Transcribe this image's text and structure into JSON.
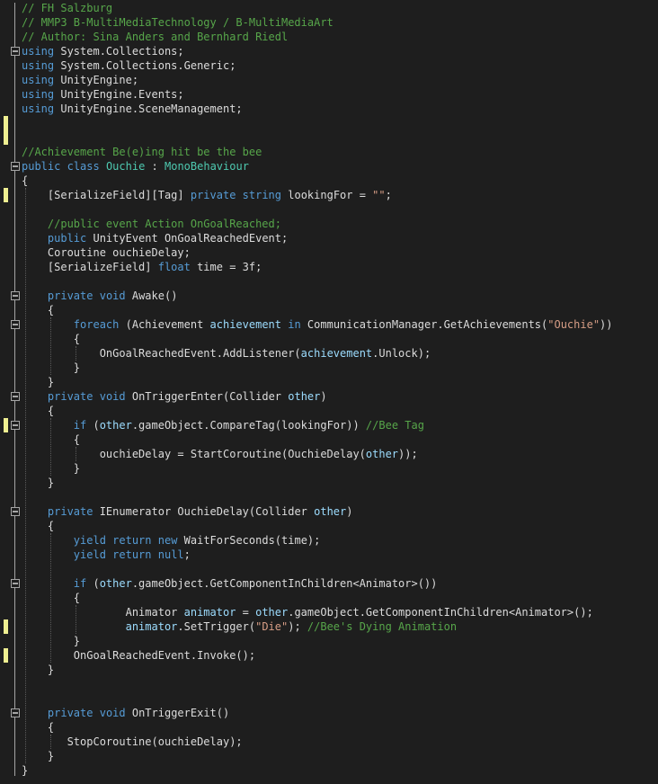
{
  "editor": {
    "theme_colors": {
      "background": "#1e1e1e",
      "keyword": "#569cd6",
      "type": "#4ec9b0",
      "string": "#d69d85",
      "comment": "#57a64a",
      "parameter": "#9cdcfe",
      "plain": "#dcdcdc",
      "change_marker": "#efef91"
    },
    "lines": [
      {
        "fold": false,
        "change": false,
        "tokens": [
          [
            "cmt",
            "// FH Salzburg"
          ]
        ]
      },
      {
        "fold": false,
        "change": false,
        "tokens": [
          [
            "cmt",
            "// MMP3 B-MultiMediaTechnology / B-MultiMediaArt"
          ]
        ]
      },
      {
        "fold": false,
        "change": false,
        "tokens": [
          [
            "cmt",
            "// Author: Sina Anders and Bernhard Riedl"
          ]
        ]
      },
      {
        "fold": true,
        "change": false,
        "tokens": [
          [
            "kw",
            "using"
          ],
          [
            "plain",
            " System.Collections;"
          ]
        ]
      },
      {
        "fold": false,
        "change": false,
        "tokens": [
          [
            "kw",
            "using"
          ],
          [
            "plain",
            " System.Collections.Generic;"
          ]
        ]
      },
      {
        "fold": false,
        "change": false,
        "tokens": [
          [
            "kw",
            "using"
          ],
          [
            "plain",
            " UnityEngine;"
          ]
        ]
      },
      {
        "fold": false,
        "change": false,
        "tokens": [
          [
            "kw",
            "using"
          ],
          [
            "plain",
            " UnityEngine.Events;"
          ]
        ]
      },
      {
        "fold": false,
        "change": false,
        "tokens": [
          [
            "kw",
            "using"
          ],
          [
            "plain",
            " UnityEngine.SceneManagement;"
          ]
        ]
      },
      {
        "fold": false,
        "change": true,
        "tokens": []
      },
      {
        "fold": false,
        "change": true,
        "tokens": []
      },
      {
        "fold": false,
        "change": false,
        "tokens": [
          [
            "cmt",
            "//Achievement Be(e)ing hit be the bee"
          ]
        ]
      },
      {
        "fold": true,
        "change": false,
        "tokens": [
          [
            "kw",
            "public"
          ],
          [
            "plain",
            " "
          ],
          [
            "kw",
            "class"
          ],
          [
            "plain",
            " "
          ],
          [
            "type",
            "Ouchie"
          ],
          [
            "plain",
            " : "
          ],
          [
            "type",
            "MonoBehaviour"
          ]
        ]
      },
      {
        "fold": false,
        "change": false,
        "tokens": [
          [
            "plain",
            "{"
          ]
        ]
      },
      {
        "fold": false,
        "change": true,
        "tokens": [
          [
            "plain",
            "    [SerializeField][Tag] "
          ],
          [
            "kw",
            "private"
          ],
          [
            "plain",
            " "
          ],
          [
            "kw",
            "string"
          ],
          [
            "plain",
            " lookingFor = "
          ],
          [
            "str",
            "\"\""
          ],
          [
            "plain",
            ";"
          ]
        ]
      },
      {
        "fold": false,
        "change": false,
        "tokens": []
      },
      {
        "fold": false,
        "change": false,
        "tokens": [
          [
            "cmt",
            "    //public event Action OnGoalReached;"
          ]
        ]
      },
      {
        "fold": false,
        "change": false,
        "tokens": [
          [
            "kw",
            "    public"
          ],
          [
            "plain",
            " UnityEvent OnGoalReachedEvent;"
          ]
        ]
      },
      {
        "fold": false,
        "change": false,
        "tokens": [
          [
            "plain",
            "    Coroutine ouchieDelay;"
          ]
        ]
      },
      {
        "fold": false,
        "change": false,
        "tokens": [
          [
            "plain",
            "    [SerializeField] "
          ],
          [
            "kw",
            "float"
          ],
          [
            "plain",
            " time = 3f;"
          ]
        ]
      },
      {
        "fold": false,
        "change": false,
        "tokens": []
      },
      {
        "fold": true,
        "change": false,
        "tokens": [
          [
            "kw",
            "    private"
          ],
          [
            "plain",
            " "
          ],
          [
            "kw",
            "void"
          ],
          [
            "plain",
            " Awake()"
          ]
        ]
      },
      {
        "fold": false,
        "change": false,
        "tokens": [
          [
            "plain",
            "    {"
          ]
        ]
      },
      {
        "fold": true,
        "change": false,
        "tokens": [
          [
            "kw",
            "        foreach"
          ],
          [
            "plain",
            " (Achievement "
          ],
          [
            "param",
            "achievement"
          ],
          [
            "plain",
            " "
          ],
          [
            "kw",
            "in"
          ],
          [
            "plain",
            " CommunicationManager.GetAchievements("
          ],
          [
            "str",
            "\"Ouchie\""
          ],
          [
            "plain",
            "))"
          ]
        ]
      },
      {
        "fold": false,
        "change": false,
        "tokens": [
          [
            "plain",
            "        {"
          ]
        ]
      },
      {
        "fold": false,
        "change": false,
        "tokens": [
          [
            "plain",
            "            OnGoalReachedEvent.AddListener("
          ],
          [
            "param",
            "achievement"
          ],
          [
            "plain",
            ".Unlock);"
          ]
        ]
      },
      {
        "fold": false,
        "change": false,
        "tokens": [
          [
            "plain",
            "        }"
          ]
        ]
      },
      {
        "fold": false,
        "change": false,
        "tokens": [
          [
            "plain",
            "    }"
          ]
        ]
      },
      {
        "fold": true,
        "change": false,
        "tokens": [
          [
            "kw",
            "    private"
          ],
          [
            "plain",
            " "
          ],
          [
            "kw",
            "void"
          ],
          [
            "plain",
            " OnTriggerEnter(Collider "
          ],
          [
            "param",
            "other"
          ],
          [
            "plain",
            ")"
          ]
        ]
      },
      {
        "fold": false,
        "change": false,
        "tokens": [
          [
            "plain",
            "    {"
          ]
        ]
      },
      {
        "fold": true,
        "change": true,
        "tokens": [
          [
            "kw",
            "        if"
          ],
          [
            "plain",
            " ("
          ],
          [
            "param",
            "other"
          ],
          [
            "plain",
            ".gameObject.CompareTag(lookingFor)) "
          ],
          [
            "cmt",
            "//Bee Tag"
          ]
        ]
      },
      {
        "fold": false,
        "change": false,
        "tokens": [
          [
            "plain",
            "        {"
          ]
        ]
      },
      {
        "fold": false,
        "change": false,
        "tokens": [
          [
            "plain",
            "            ouchieDelay = StartCoroutine(OuchieDelay("
          ],
          [
            "param",
            "other"
          ],
          [
            "plain",
            "));"
          ]
        ]
      },
      {
        "fold": false,
        "change": false,
        "tokens": [
          [
            "plain",
            "        }"
          ]
        ]
      },
      {
        "fold": false,
        "change": false,
        "tokens": [
          [
            "plain",
            "    }"
          ]
        ]
      },
      {
        "fold": false,
        "change": false,
        "tokens": []
      },
      {
        "fold": true,
        "change": false,
        "tokens": [
          [
            "kw",
            "    private"
          ],
          [
            "plain",
            " IEnumerator OuchieDelay(Collider "
          ],
          [
            "param",
            "other"
          ],
          [
            "plain",
            ")"
          ]
        ]
      },
      {
        "fold": false,
        "change": false,
        "tokens": [
          [
            "plain",
            "    {"
          ]
        ]
      },
      {
        "fold": false,
        "change": false,
        "tokens": [
          [
            "kw",
            "        yield"
          ],
          [
            "plain",
            " "
          ],
          [
            "kw",
            "return"
          ],
          [
            "plain",
            " "
          ],
          [
            "kw",
            "new"
          ],
          [
            "plain",
            " WaitForSeconds(time);"
          ]
        ]
      },
      {
        "fold": false,
        "change": false,
        "tokens": [
          [
            "kw",
            "        yield"
          ],
          [
            "plain",
            " "
          ],
          [
            "kw",
            "return"
          ],
          [
            "plain",
            " "
          ],
          [
            "kw",
            "null"
          ],
          [
            "plain",
            ";"
          ]
        ]
      },
      {
        "fold": false,
        "change": false,
        "tokens": []
      },
      {
        "fold": true,
        "change": false,
        "tokens": [
          [
            "kw",
            "        if"
          ],
          [
            "plain",
            " ("
          ],
          [
            "param",
            "other"
          ],
          [
            "plain",
            ".gameObject.GetComponentInChildren<Animator>())"
          ]
        ]
      },
      {
        "fold": false,
        "change": false,
        "tokens": [
          [
            "plain",
            "        {"
          ]
        ]
      },
      {
        "fold": false,
        "change": false,
        "tokens": [
          [
            "plain",
            "                Animator "
          ],
          [
            "param",
            "animator"
          ],
          [
            "plain",
            " = "
          ],
          [
            "param",
            "other"
          ],
          [
            "plain",
            ".gameObject.GetComponentInChildren<Animator>();"
          ]
        ]
      },
      {
        "fold": false,
        "change": true,
        "tokens": [
          [
            "plain",
            "                "
          ],
          [
            "param",
            "animator"
          ],
          [
            "plain",
            ".SetTrigger("
          ],
          [
            "str",
            "\"Die\""
          ],
          [
            "plain",
            "); "
          ],
          [
            "cmt",
            "//Bee's Dying Animation"
          ]
        ]
      },
      {
        "fold": false,
        "change": false,
        "tokens": [
          [
            "plain",
            "        }"
          ]
        ]
      },
      {
        "fold": false,
        "change": true,
        "tokens": [
          [
            "plain",
            "        OnGoalReachedEvent.Invoke();"
          ]
        ]
      },
      {
        "fold": false,
        "change": false,
        "tokens": [
          [
            "plain",
            "    }"
          ]
        ]
      },
      {
        "fold": false,
        "change": false,
        "tokens": []
      },
      {
        "fold": false,
        "change": false,
        "tokens": []
      },
      {
        "fold": true,
        "change": false,
        "tokens": [
          [
            "kw",
            "    private"
          ],
          [
            "plain",
            " "
          ],
          [
            "kw",
            "void"
          ],
          [
            "plain",
            " OnTriggerExit()"
          ]
        ]
      },
      {
        "fold": false,
        "change": false,
        "tokens": [
          [
            "plain",
            "    {"
          ]
        ]
      },
      {
        "fold": false,
        "change": false,
        "tokens": [
          [
            "plain",
            "       StopCoroutine(ouchieDelay);"
          ]
        ]
      },
      {
        "fold": false,
        "change": false,
        "tokens": [
          [
            "plain",
            "    }"
          ]
        ]
      },
      {
        "fold": false,
        "change": false,
        "tokens": [
          [
            "plain",
            "}"
          ]
        ]
      }
    ]
  }
}
